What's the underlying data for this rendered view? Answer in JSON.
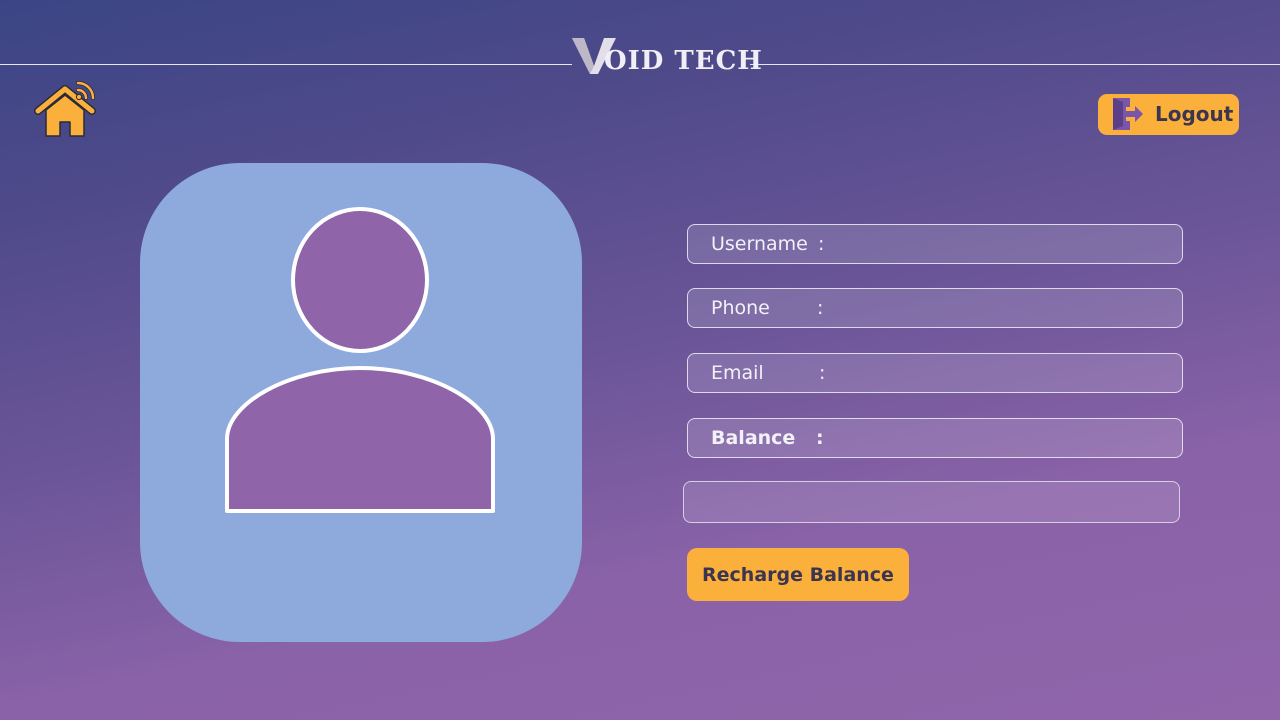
{
  "header": {
    "brand_mark": "V",
    "brand_name": "OID TECH",
    "home_icon": "home-wifi-icon",
    "logout_icon": "exit-door-icon",
    "logout_label": "Logout"
  },
  "profile": {
    "avatar_icon": "user-silhouette-icon",
    "fields": [
      {
        "label": "Username",
        "separator": ":",
        "value": ""
      },
      {
        "label": "Phone",
        "separator": ":",
        "value": ""
      },
      {
        "label": "Email",
        "separator": ":",
        "value": ""
      },
      {
        "label": "Balance",
        "separator": ":",
        "value": ""
      }
    ],
    "recharge_input": {
      "value": "",
      "placeholder": ""
    },
    "recharge_button_label": "Recharge Balance"
  },
  "colors": {
    "accent": "#fbb03b",
    "avatar_bg": "#8eaadc",
    "avatar_fill": "#8f64a8",
    "gradient_top": "#3b4585",
    "gradient_bottom": "#9065aa"
  }
}
